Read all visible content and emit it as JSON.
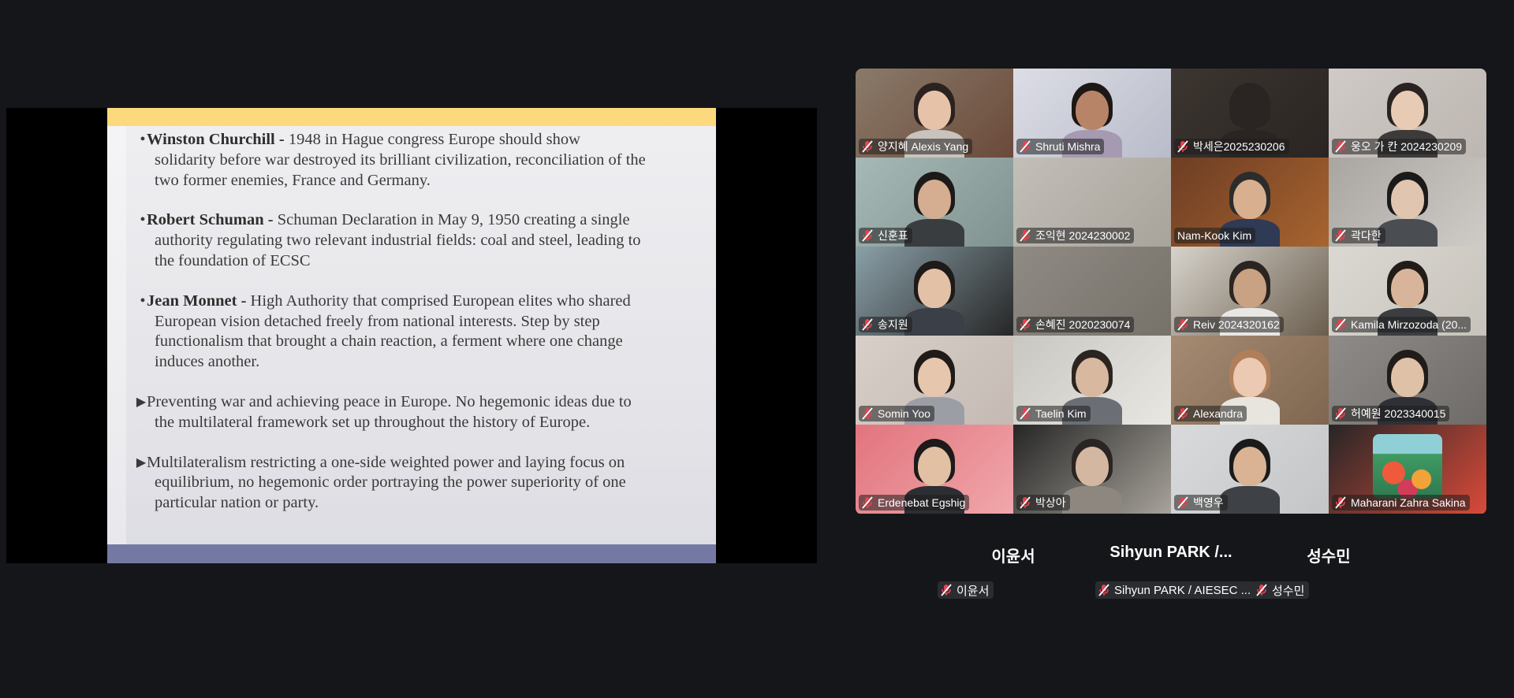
{
  "slide": {
    "bullets": [
      {
        "type": "dot",
        "lead": "Winston Churchill -",
        "lines": [
          " 1948 in Hague congress Europe should show",
          "solidarity before war destroyed its brilliant civilization, reconciliation of the",
          "two former enemies, France and Germany."
        ]
      },
      {
        "type": "dot",
        "lead": "Robert Schuman -",
        "lines": [
          " Schuman Declaration in May 9, 1950 creating a single",
          "authority regulating two relevant industrial fields: coal and steel, leading to",
          "the foundation of ECSC"
        ]
      },
      {
        "type": "dot",
        "lead": "Jean Monnet -",
        "lines": [
          " High Authority that comprised European elites who shared",
          "European vision detached freely from national interests. Step by step",
          "functionalism that brought a chain reaction, a ferment where one change",
          "induces another."
        ]
      },
      {
        "type": "arrow",
        "lead": "",
        "lines": [
          "Preventing war and achieving peace in Europe. No hegemonic ideas due to",
          "the multilateral framework set up throughout the history of Europe."
        ]
      },
      {
        "type": "arrow",
        "lead": "",
        "lines": [
          "Multilateralism restricting a one-side weighted power and laying focus on",
          "equilibrium, no hegemonic order portraying the power superiority of one",
          "particular nation or party."
        ]
      }
    ]
  },
  "participants": [
    {
      "name": "양지혜 Alexis Yang",
      "muted": true,
      "bg": "#8a7a6a",
      "accent": "#6b4a3a",
      "skin": "#e6c3a8",
      "hair": "#2b2220",
      "shirt": "#c9c3bd"
    },
    {
      "name": "Shruti Mishra",
      "muted": true,
      "bg": "#dcdde6",
      "accent": "#b9bcc9",
      "skin": "#b88468",
      "hair": "#1d1715",
      "shirt": "#a59ab2"
    },
    {
      "name": "박세은2025230206",
      "muted": true,
      "bg": "#3c3530",
      "accent": "#2a2522",
      "skin": "#2a2522",
      "hair": "#2a2522",
      "shirt": "#2a2522"
    },
    {
      "name": "웅오 가 칸 2024230209",
      "muted": true,
      "bg": "#cfcac6",
      "accent": "#bdb6b1",
      "skin": "#e8cbb5",
      "hair": "#2a2321",
      "shirt": "#3d3a3a"
    },
    {
      "name": "신훈표",
      "muted": true,
      "bg": "#a7b9b6",
      "accent": "#7f928f",
      "skin": "#d5ad90",
      "hair": "#1c1a19",
      "shirt": "#3a3d40"
    },
    {
      "name": "조익현 2024230002",
      "muted": true,
      "bg": "#c3bfb8",
      "accent": "#a8a39b",
      "skin": "#c3bfb8",
      "hair": "#c3bfb8",
      "shirt": "#c3bfb8"
    },
    {
      "name": "Nam-Kook Kim",
      "muted": false,
      "bg": "#6d3d24",
      "accent": "#a8642f",
      "skin": "#d9b08f",
      "hair": "#2c2c2c",
      "shirt": "#2f3a55"
    },
    {
      "name": "곽다한",
      "muted": true,
      "bg": "#a9a6a2",
      "accent": "#cfccc8",
      "skin": "#e0c5b0",
      "hair": "#1b1a1a",
      "shirt": "#4a4d52"
    },
    {
      "name": "송지원",
      "muted": true,
      "bg": "#8aa0a8",
      "accent": "#262626",
      "skin": "#e3c1a6",
      "hair": "#1e1a18",
      "shirt": "#3b3f48"
    },
    {
      "name": "손혜진 2020230074",
      "muted": true,
      "bg": "#8f8b84",
      "accent": "#767169",
      "skin": "#8f8b84",
      "hair": "#8f8b84",
      "shirt": "#8f8b84"
    },
    {
      "name": "Reiv 2024320162",
      "muted": true,
      "bg": "#d7d3cc",
      "accent": "#6a5e4e",
      "skin": "#c9a283",
      "hair": "#2b2522",
      "shirt": "#e9e7e3"
    },
    {
      "name": "Kamila Mirzozoda (20...",
      "muted": true,
      "bg": "#dbd8d2",
      "accent": "#c7c3bb",
      "skin": "#d8b59a",
      "hair": "#221c19",
      "shirt": "#3b3d41"
    },
    {
      "name": "Somin Yoo",
      "muted": true,
      "bg": "#d8cfc9",
      "accent": "#c4bab3",
      "skin": "#e6c7ad",
      "hair": "#1f1b19",
      "shirt": "#9c9ea6"
    },
    {
      "name": "Taelin Kim",
      "muted": true,
      "bg": "#c9c7c2",
      "accent": "#e9e7e2",
      "skin": "#d8b99f",
      "hair": "#2b2421",
      "shirt": "#6b6f75"
    },
    {
      "name": "Alexandra",
      "muted": true,
      "bg": "#a58b72",
      "accent": "#7f6650",
      "skin": "#ebc9b2",
      "hair": "#b07f59",
      "shirt": "#e8e4de"
    },
    {
      "name": "허예원 2023340015",
      "muted": true,
      "bg": "#8e8b88",
      "accent": "#6e6b68",
      "skin": "#dfc1a8",
      "hair": "#201c1a",
      "shirt": "#2e3036"
    },
    {
      "name": "Erdenebat Egshig",
      "muted": true,
      "bg": "#e2747e",
      "accent": "#f0a7ab",
      "skin": "#e1c0a4",
      "hair": "#1d1a19",
      "shirt": "#2d2e33"
    },
    {
      "name": "박상아",
      "muted": true,
      "bg": "#262626",
      "accent": "#a7a29a",
      "skin": "#d4b7a0",
      "hair": "#2a2522",
      "shirt": "#8d8780"
    },
    {
      "name": "백영우",
      "muted": true,
      "bg": "#d9dadb",
      "accent": "#c3c5c7",
      "skin": "#d9b394",
      "hair": "#1b1a1a",
      "shirt": "#3e4145"
    },
    {
      "name": "Maharani Zahra Sakina",
      "muted": true,
      "bg": "#262626",
      "accent": "#d94a3a",
      "skin": "#262626",
      "hair": "#262626",
      "shirt": "#262626"
    }
  ],
  "audio_only": [
    {
      "name": "이윤서",
      "tag": "이윤서"
    },
    {
      "name": "Sihyun  PARK /...",
      "tag": "Sihyun PARK / AIESEC ..."
    },
    {
      "name": "성수민",
      "tag": "성수민"
    }
  ],
  "colors": {
    "active_speaker": "#23d959",
    "muted_icon": "#e8414e"
  }
}
